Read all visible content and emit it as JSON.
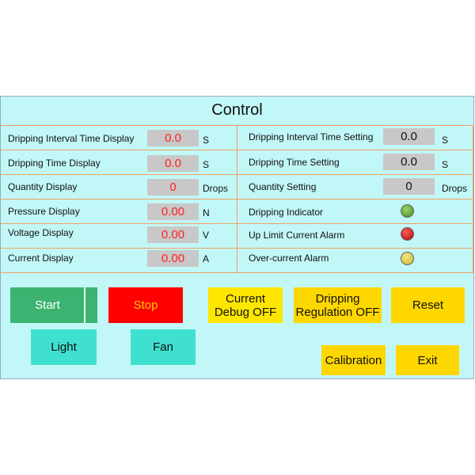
{
  "title": "Control",
  "rows": [
    {
      "left_label": "Dripping Interval Time Display",
      "left_value": "0.0",
      "left_unit": "S",
      "right_label": "Dripping Interval Time Setting",
      "right_value": "0.0",
      "right_unit": "S"
    },
    {
      "left_label": "Dripping Time Display",
      "left_value": "0.0",
      "left_unit": "S",
      "right_label": "Dripping Time Setting",
      "right_value": "0.0",
      "right_unit": "S"
    },
    {
      "left_label": "Quantity Display",
      "left_value": "0",
      "left_unit": "Drops",
      "right_label": "Quantity Setting",
      "right_value": "0",
      "right_unit": "Drops"
    },
    {
      "left_label": "Pressure Display",
      "left_value": "0.00",
      "left_unit": "N",
      "right_label": "Dripping Indicator",
      "right_lamp": "green"
    },
    {
      "left_label": "Voltage Display",
      "left_value": "0.00",
      "left_unit": "V",
      "right_label": "Up Limit Current  Alarm",
      "right_lamp": "red"
    },
    {
      "left_label": "Current Display",
      "left_value": "0.00",
      "left_unit": "A",
      "right_label": "Over-current  Alarm",
      "right_lamp": "yellow"
    }
  ],
  "buttons": {
    "start": "Start",
    "stop": "Stop",
    "current_debug_line1": "Current",
    "current_debug_line2": "Debug OFF",
    "dripping_reg_line1": "Dripping",
    "dripping_reg_line2": "Regulation OFF",
    "reset": "Reset",
    "light": "Light",
    "fan": "Fan",
    "calibration": "Calibration",
    "exit": "Exit"
  },
  "colors": {
    "panel_bg": "#c2f7f7",
    "grid_line": "#f0a060",
    "value_red": "#ff2020",
    "start_green": "#3cb371",
    "stop_red": "#ff0000",
    "teal": "#40e0d0",
    "yellow": "#ffe600",
    "gold": "#ffd700"
  }
}
